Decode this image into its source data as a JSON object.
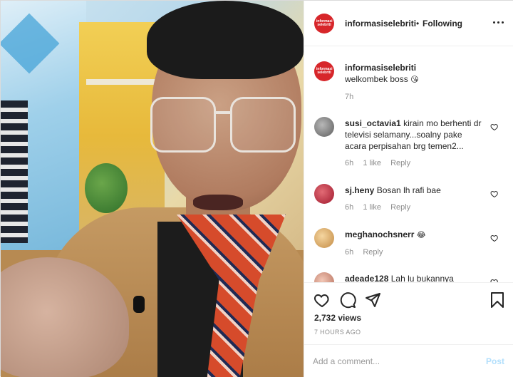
{
  "header": {
    "username": "informasiselebriti",
    "separator": "•",
    "follow_status": "Following",
    "avatar_text": "informasi selebriti"
  },
  "caption": {
    "username": "informasiselebriti",
    "text": "welkombek boss",
    "emoji": "😘",
    "time": "7h"
  },
  "comments": [
    {
      "username": "susi_octavia1",
      "text": "kirain mo berhenti dr televisi selamany...soalny pake acara perpisahan brg temen2...",
      "time": "6h",
      "likes": "1 like",
      "reply": "Reply"
    },
    {
      "username": "sj.heny",
      "text": "Bosan lh rafi bae",
      "time": "6h",
      "likes": "1 like",
      "reply": "Reply"
    },
    {
      "username": "meghanochsnerr",
      "text": "",
      "emoji": "😂",
      "time": "6h",
      "reply": "Reply"
    },
    {
      "username": "adeade128",
      "text": "Lah lu bukannya"
    }
  ],
  "actions": {
    "views": "2,732 views",
    "posted": "7 HOURS AGO"
  },
  "add_comment": {
    "placeholder": "Add a comment...",
    "post_label": "Post"
  },
  "colors": {
    "brand_red": "#d7262a",
    "post_disabled": "#b2dffc",
    "meta_gray": "#8e8e8e"
  },
  "icons": [
    "more-options-icon",
    "heart-icon",
    "comment-icon",
    "share-icon",
    "bookmark-icon"
  ]
}
